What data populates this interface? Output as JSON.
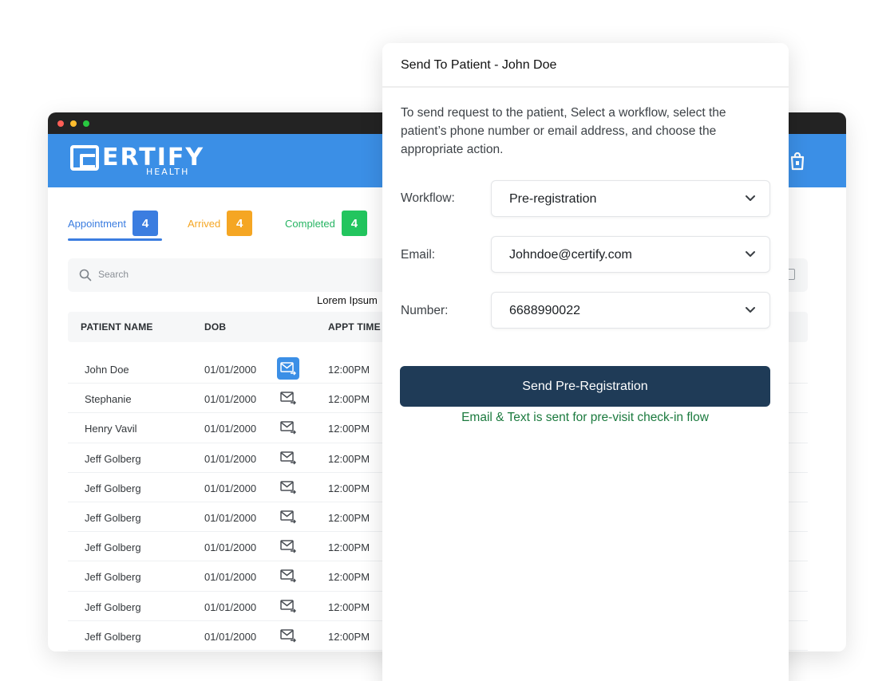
{
  "app": {
    "logo_text": "ERTIFY",
    "logo_sub": "HEALTH"
  },
  "tabs": [
    {
      "label": "Appointment",
      "count": "4",
      "color": "#3b7de0"
    },
    {
      "label": "Arrived",
      "count": "4",
      "color": "#f5a623"
    },
    {
      "label": "Completed",
      "count": "4",
      "color": "#22c55e"
    }
  ],
  "search": {
    "placeholder": "Search"
  },
  "tooltip": "Lorem Ipsum",
  "table": {
    "headers": {
      "name": "PATIENT NAME",
      "dob": "DOB",
      "time": "APPT TIME"
    },
    "rows": [
      {
        "name": "John Doe",
        "dob": "01/01/2000",
        "time": "12:00PM"
      },
      {
        "name": "Stephanie",
        "dob": "01/01/2000",
        "time": "12:00PM"
      },
      {
        "name": "Henry Vavil",
        "dob": "01/01/2000",
        "time": "12:00PM"
      },
      {
        "name": "Jeff Golberg",
        "dob": "01/01/2000",
        "time": "12:00PM"
      },
      {
        "name": "Jeff Golberg",
        "dob": "01/01/2000",
        "time": "12:00PM"
      },
      {
        "name": "Jeff Golberg",
        "dob": "01/01/2000",
        "time": "12:00PM"
      },
      {
        "name": "Jeff Golberg",
        "dob": "01/01/2000",
        "time": "12:00PM"
      },
      {
        "name": "Jeff Golberg",
        "dob": "01/01/2000",
        "time": "12:00PM"
      },
      {
        "name": "Jeff Golberg",
        "dob": "01/01/2000",
        "time": "12:00PM"
      },
      {
        "name": "Jeff Golberg",
        "dob": "01/01/2000",
        "time": "12:00PM"
      }
    ]
  },
  "panel": {
    "title": "Send To Patient - John Doe",
    "description": "To send request to the patient, Select a workflow, select the patient’s phone number or email address, and choose the appropriate action.",
    "workflow_label": "Workflow:",
    "workflow_value": "Pre-registration",
    "email_label": "Email:",
    "email_value": "Johndoe@certify.com",
    "number_label": "Number:",
    "number_value": "6688990022",
    "send_button": "Send Pre-Registration",
    "status_note": "Email & Text is sent for pre-visit check-in flow"
  },
  "colors": {
    "brand": "#3b8fe6",
    "button": "#1f3b57",
    "success_text": "#1b7a3e"
  }
}
